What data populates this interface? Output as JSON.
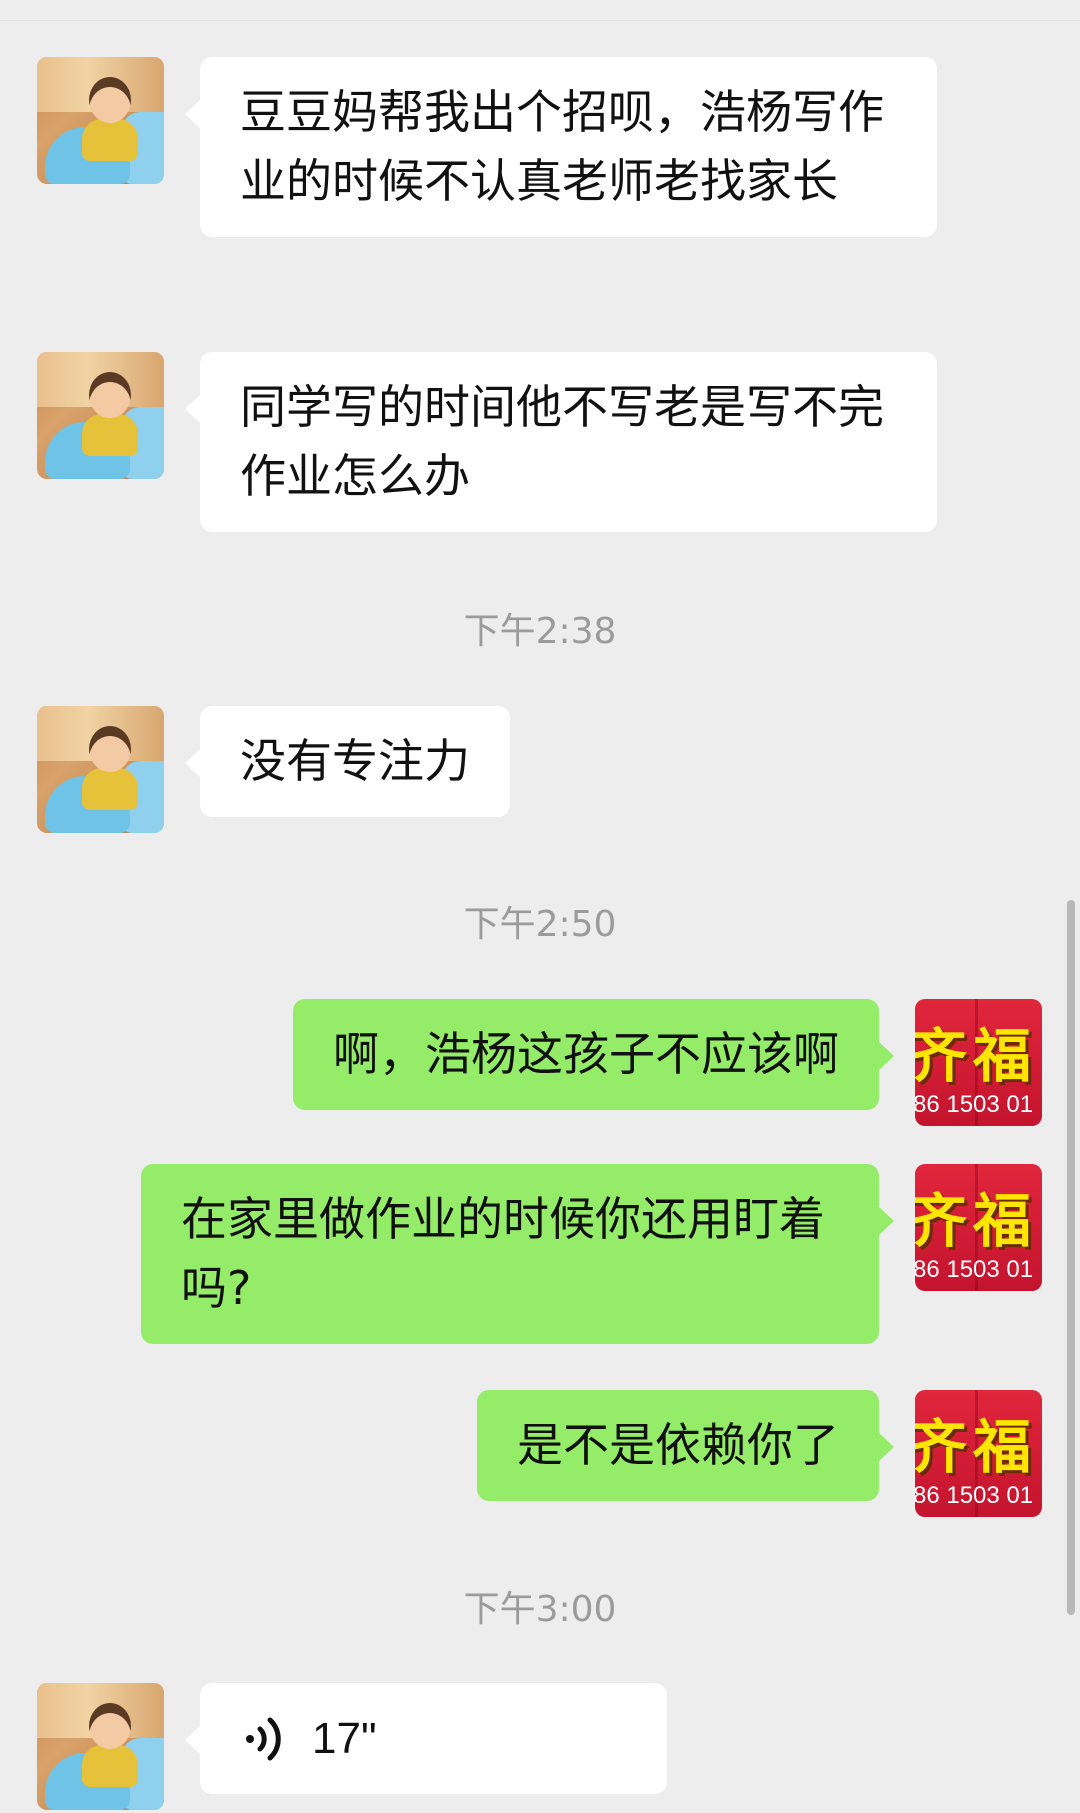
{
  "messages": [
    {
      "side": "left",
      "type": "text",
      "text": "豆豆妈帮我出个招呗，浩杨写作业的时候不认真老师老找家长"
    },
    {
      "side": "left",
      "type": "text",
      "text": "同学写的时间他不写老是写不完作业怎么办"
    },
    {
      "side": "left",
      "type": "text",
      "text": "没有专注力"
    },
    {
      "side": "right",
      "type": "text",
      "text": "啊，浩杨这孩子不应该啊"
    },
    {
      "side": "right",
      "type": "text",
      "text": "在家里做作业的时候你还用盯着吗?"
    },
    {
      "side": "right",
      "type": "text",
      "text": "是不是依赖你了"
    },
    {
      "side": "left",
      "type": "voice",
      "duration": "17\"",
      "icon": "voice-wave-icon"
    }
  ],
  "timestamps": [
    "下午2:38",
    "下午2:50",
    "下午3:00"
  ],
  "avatars": {
    "contact": {
      "icon": "baby-photo-avatar"
    },
    "self": {
      "icon": "red-banner-avatar",
      "text": "齐福",
      "number": "86 1503 01"
    }
  },
  "colors": {
    "background": "#ededed",
    "incoming_bubble": "#ffffff",
    "outgoing_bubble": "#95ec69",
    "timestamp_text": "#9b9b9b",
    "self_avatar": "#d01b34",
    "self_avatar_text": "#ffe600"
  }
}
